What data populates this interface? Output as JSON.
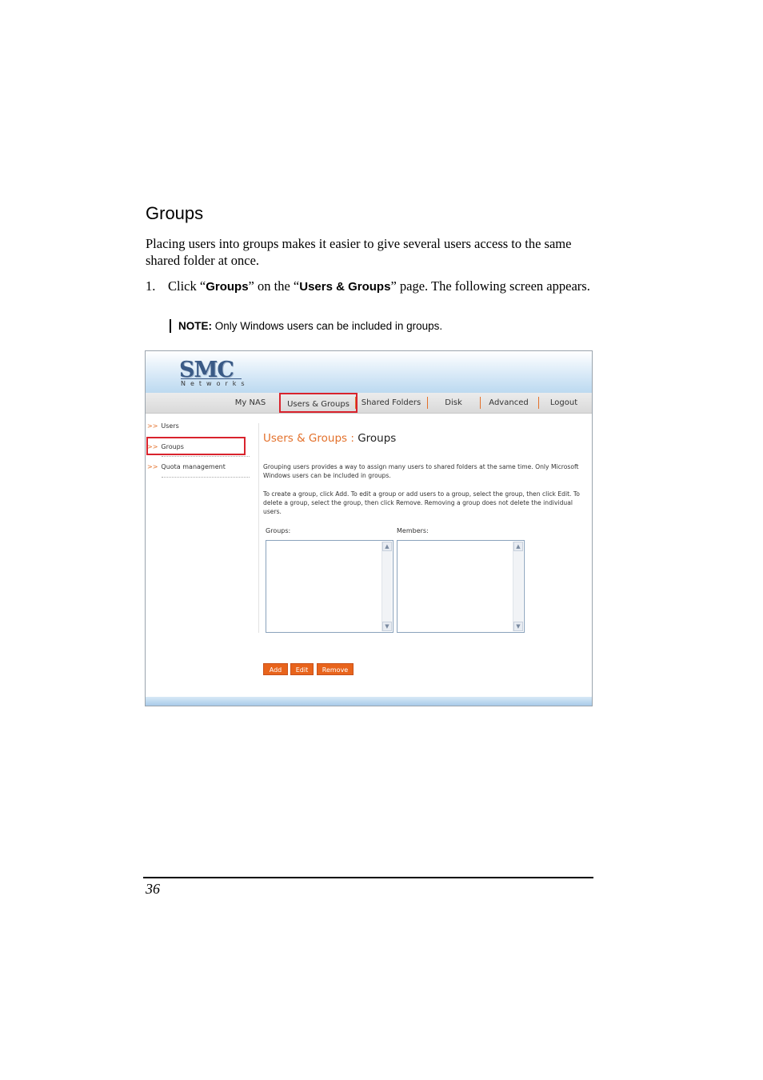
{
  "doc": {
    "heading": "Groups",
    "intro": "Placing users into groups makes it easier to give several users access to the same shared folder at once.",
    "step": {
      "number": "1.",
      "text_a": "Click “",
      "bold_a": "Groups",
      "text_b": "” on the “",
      "bold_b": "Users & Groups",
      "text_c": "” page. The following screen appears."
    },
    "note": {
      "label": "NOTE:",
      "text": " Only Windows users can be included in groups."
    },
    "page_number": "36"
  },
  "screen": {
    "logo": "SMC",
    "logo_sub": "Networks",
    "nav": [
      "My NAS",
      "Users & Groups",
      "Shared Folders",
      "Disk",
      "Advanced",
      "Logout"
    ],
    "sidebar": {
      "arrow": ">>",
      "items": [
        "Users",
        "Groups",
        "Quota management"
      ]
    },
    "title_section": "Users & Groups :",
    "title_page": "Groups",
    "para1": "Grouping users provides a way to assign many users to shared folders at the same time. Only Microsoft Windows users can be included in groups.",
    "para2": "To create a group, click Add. To edit a group or add users to a group, select the group, then click Edit. To delete a group, select the group, then click Remove. Removing a group does not delete the individual users.",
    "groups_label": "Groups:",
    "members_label": "Members:",
    "buttons": {
      "add": "Add",
      "edit": "Edit",
      "remove": "Remove"
    }
  }
}
